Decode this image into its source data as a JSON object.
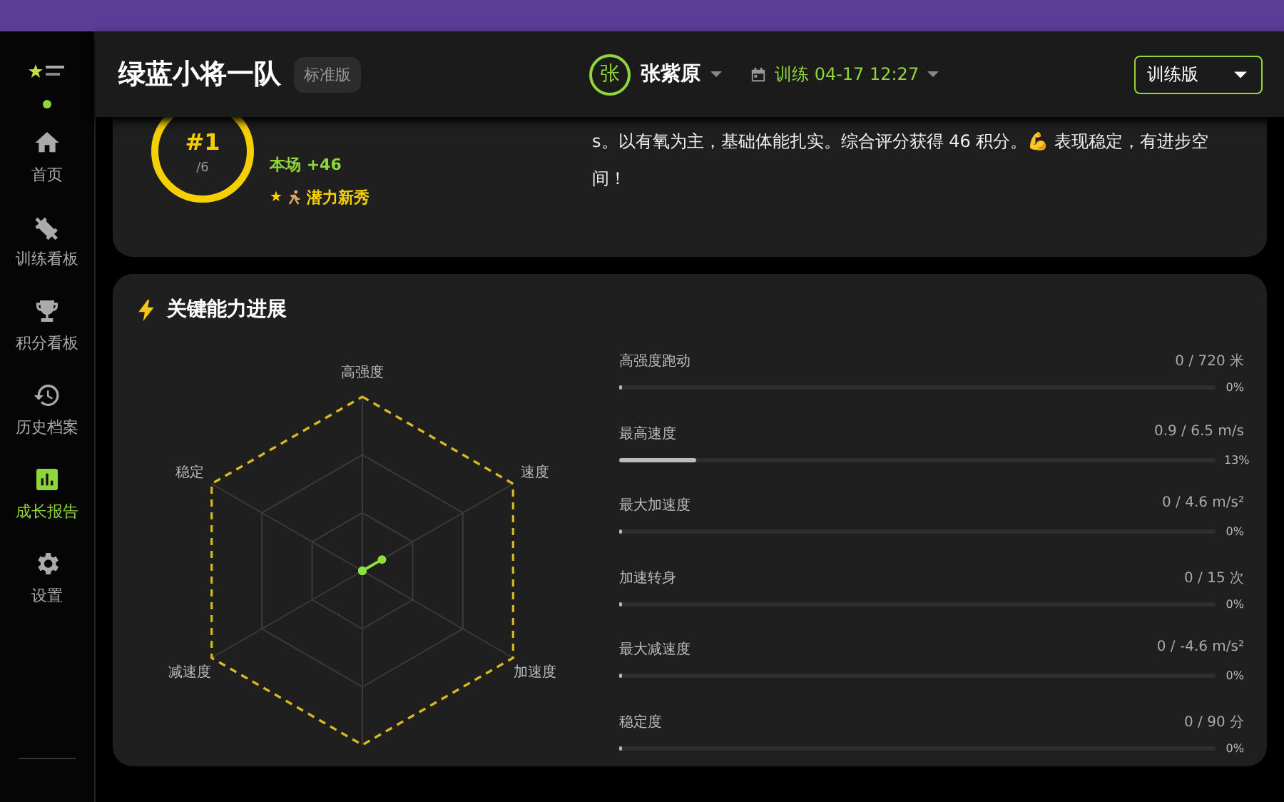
{
  "header": {
    "team": "绿蓝小将一队",
    "edition_badge": "标准版",
    "player": {
      "initial": "张",
      "name": "张紫原"
    },
    "session": "训练 04-17 12:27",
    "mode_select": {
      "value": "训练版"
    }
  },
  "sidebar": {
    "items": [
      {
        "label": "首页",
        "selected": false
      },
      {
        "label": "训练看板",
        "selected": false
      },
      {
        "label": "积分看板",
        "selected": false
      },
      {
        "label": "历史档案",
        "selected": false
      },
      {
        "label": "成长报告",
        "selected": true
      },
      {
        "label": "设置",
        "selected": false
      }
    ]
  },
  "summary_card": {
    "rank": "#1",
    "rank_total": "/6",
    "match_points": "本场 +46",
    "badge_star": "★",
    "badge": "潜力新秀",
    "comment": "s。以有氧为主，基础体能扎实。综合评分获得 46 积分。💪 表现稳定，有进步空间！"
  },
  "ability_card": {
    "title": "关键能力进展",
    "metrics": [
      {
        "radar_label": "高强度",
        "name": "高强度跑动",
        "reading": "0 / 720 米",
        "level": 0,
        "percent": "0%"
      },
      {
        "radar_label": "速度",
        "name": "最高速度",
        "reading": "0.9 / 6.5 m/s",
        "level": 0.13,
        "percent": "13%"
      },
      {
        "radar_label": "加速度",
        "name": "最大加速度",
        "reading": "0 / 4.6 m/s²",
        "level": 0,
        "percent": "0%"
      },
      {
        "name": "加速转身",
        "reading": "0 / 15 次",
        "level": 0,
        "percent": "0%"
      },
      {
        "radar_label": "减速度",
        "name": "最大减速度",
        "reading": "0 / -4.6 m/s²",
        "level": 0,
        "percent": "0%"
      },
      {
        "radar_label": "稳定",
        "name": "稳定度",
        "reading": "0 / 90 分",
        "level": 0,
        "percent": "0%"
      }
    ]
  }
}
